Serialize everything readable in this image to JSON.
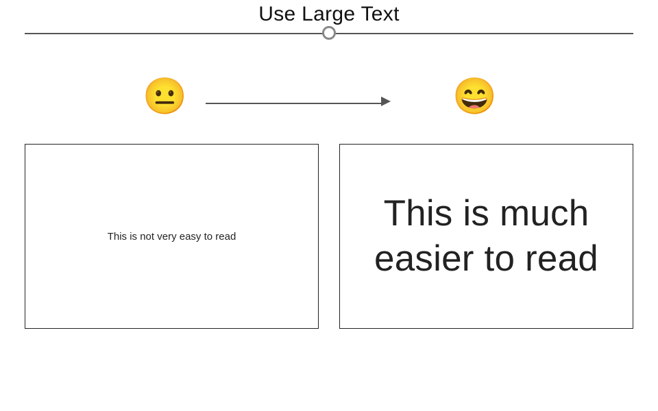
{
  "title": "Use Large Text",
  "emoji_left": "😐",
  "emoji_right": "😄",
  "panel_left_text": "This is not very easy to read",
  "panel_right_text": "This is much easier to read"
}
